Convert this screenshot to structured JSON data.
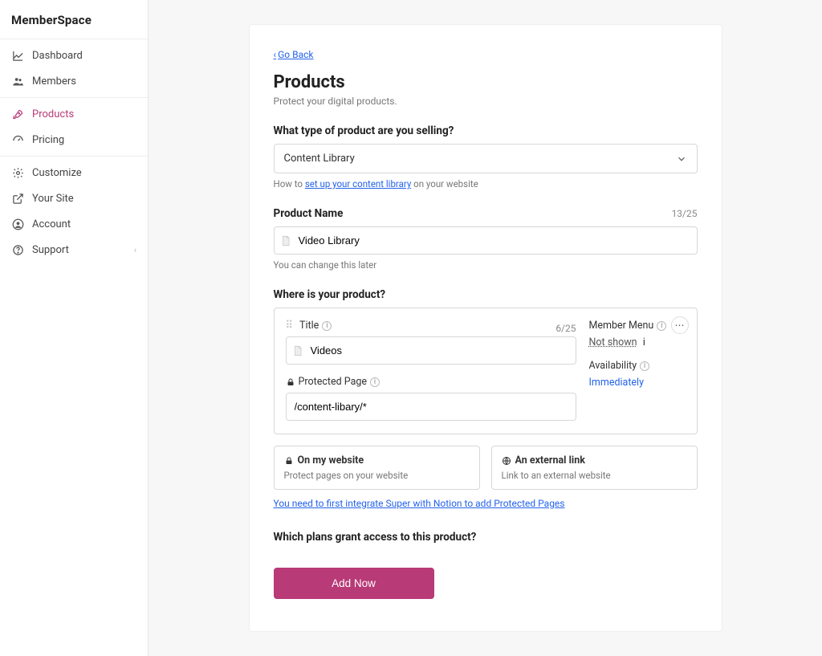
{
  "logo": "MemberSpace",
  "sidebar": {
    "group1": [
      {
        "label": "Dashboard"
      },
      {
        "label": "Members"
      }
    ],
    "group2": [
      {
        "label": "Products"
      },
      {
        "label": "Pricing"
      }
    ],
    "group3": [
      {
        "label": "Customize"
      },
      {
        "label": "Your Site"
      },
      {
        "label": "Account"
      },
      {
        "label": "Support"
      }
    ]
  },
  "goback": "Go Back",
  "pageTitle": "Products",
  "pageSub": "Protect your digital products.",
  "typeLabel": "What type of product are you selling?",
  "typeValue": "Content Library",
  "typeHelpPrefix": "How to ",
  "typeHelpLink": "set up your content library",
  "typeHelpSuffix": " on your website",
  "nameLabel": "Product Name",
  "nameCounter": "13/25",
  "nameValue": "Video Library",
  "nameHelp": "You can change this later",
  "whereLabel": "Where is your product?",
  "panel": {
    "titleLabel": "Title",
    "titleCounter": "6/25",
    "titleValue": "Videos",
    "protectedLabel": "Protected Page",
    "protectedValue": "/content-libary/*",
    "memberMenuLabel": "Member Menu",
    "memberMenuValue": "Not shown",
    "availabilityLabel": "Availability",
    "availabilityValue": "Immediately"
  },
  "options": {
    "onWebsiteTitle": "On my website",
    "onWebsiteSub": "Protect pages on your website",
    "externalTitle": "An external link",
    "externalSub": "Link to an external website"
  },
  "integrateNote": "You need to first integrate Super with Notion to add Protected Pages",
  "plansLabel": "Which plans grant access to this product?",
  "addNow": "Add Now"
}
